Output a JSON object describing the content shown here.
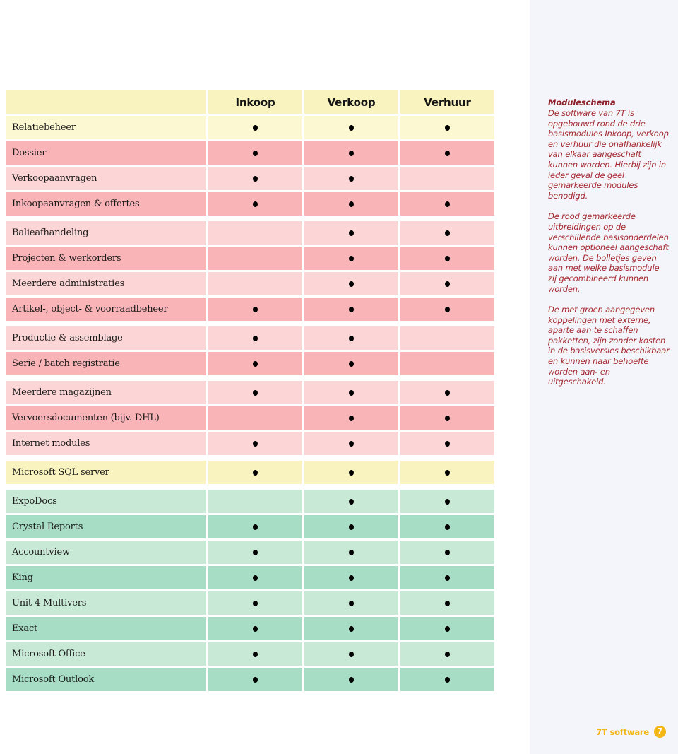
{
  "table": {
    "columns": [
      "Inkoop",
      "Verkoop",
      "Verhuur"
    ],
    "rows": [
      {
        "label": "Relatiebeheer",
        "marks": [
          true,
          true,
          true
        ],
        "tone": "yellow-a"
      },
      {
        "label": "Dossier",
        "marks": [
          true,
          true,
          true
        ],
        "tone": "pink-dark"
      },
      {
        "label": "Verkoopaanvragen",
        "marks": [
          true,
          true,
          false
        ],
        "tone": "pink-light"
      },
      {
        "label": "Inkoopaanvragen & offertes",
        "marks": [
          true,
          true,
          true
        ],
        "tone": "pink-dark"
      },
      {
        "label": "Balieafhandeling",
        "marks": [
          false,
          true,
          true
        ],
        "tone": "pink-light",
        "gap_before": true
      },
      {
        "label": "Projecten & werkorders",
        "marks": [
          false,
          true,
          true
        ],
        "tone": "pink-dark"
      },
      {
        "label": "Meerdere administraties",
        "marks": [
          false,
          true,
          true
        ],
        "tone": "pink-light"
      },
      {
        "label": "Artikel-, object- & voorraadbeheer",
        "marks": [
          true,
          true,
          true
        ],
        "tone": "pink-dark"
      },
      {
        "label": "Productie & assemblage",
        "marks": [
          true,
          true,
          false
        ],
        "tone": "pink-light",
        "gap_before": true
      },
      {
        "label": "Serie / batch registratie",
        "marks": [
          true,
          true,
          false
        ],
        "tone": "pink-dark"
      },
      {
        "label": "Meerdere magazijnen",
        "marks": [
          true,
          true,
          true
        ],
        "tone": "pink-light",
        "gap_before": true
      },
      {
        "label": "Vervoersdocumenten (bijv. DHL)",
        "marks": [
          false,
          true,
          true
        ],
        "tone": "pink-dark"
      },
      {
        "label": "Internet modules",
        "marks": [
          true,
          true,
          true
        ],
        "tone": "pink-light"
      },
      {
        "label": "Microsoft SQL server",
        "marks": [
          true,
          true,
          true
        ],
        "tone": "yellow-b",
        "gap_before": true
      },
      {
        "label": "ExpoDocs",
        "marks": [
          false,
          true,
          true
        ],
        "tone": "green-light",
        "gap_before": true
      },
      {
        "label": "Crystal Reports",
        "marks": [
          true,
          true,
          true
        ],
        "tone": "green-dark"
      },
      {
        "label": "Accountview",
        "marks": [
          true,
          true,
          true
        ],
        "tone": "green-light"
      },
      {
        "label": "King",
        "marks": [
          true,
          true,
          true
        ],
        "tone": "green-dark"
      },
      {
        "label": "Unit 4 Multivers",
        "marks": [
          true,
          true,
          true
        ],
        "tone": "green-light"
      },
      {
        "label": "Exact",
        "marks": [
          true,
          true,
          true
        ],
        "tone": "green-dark"
      },
      {
        "label": "Microsoft Office",
        "marks": [
          true,
          true,
          true
        ],
        "tone": "green-light"
      },
      {
        "label": "Microsoft Outlook",
        "marks": [
          true,
          true,
          true
        ],
        "tone": "green-dark"
      }
    ]
  },
  "side_panel": {
    "title": "Moduleschema",
    "paragraphs": [
      "De software van 7T is opgebouwd rond de drie basismodules Inkoop, verkoop en verhuur die onafhankelijk van elkaar aangeschaft kunnen worden. Hierbij zijn in ieder geval de geel gemarkeerde modules benodigd.",
      "De rood gemarkeerde uitbreidingen op de verschillende basisonderdelen kunnen optioneel aangeschaft worden. De bolletjes geven aan met welke basismodule zij gecombineerd kunnen worden.",
      "De met groen aangegeven koppelingen met externe, aparte aan te schaffen pakketten, zijn zonder kosten in de basisversies beschikbaar en kunnen naar behoefte worden aan- en uitgeschakeld."
    ]
  },
  "footer": {
    "label": "7T software",
    "page_number": "7"
  },
  "colors": {
    "yellow_light": "#fcf8d2",
    "yellow": "#f9f3bf",
    "pink_dark": "#f9b4b7",
    "pink_light": "#fcd6d6",
    "green_dark": "#a6ddc4",
    "green_light": "#c8e9d6",
    "panel_bg": "#f4f4fb",
    "panel_text": "#a42a2f",
    "panel_title": "#8e1f28",
    "accent": "#f5b618"
  }
}
